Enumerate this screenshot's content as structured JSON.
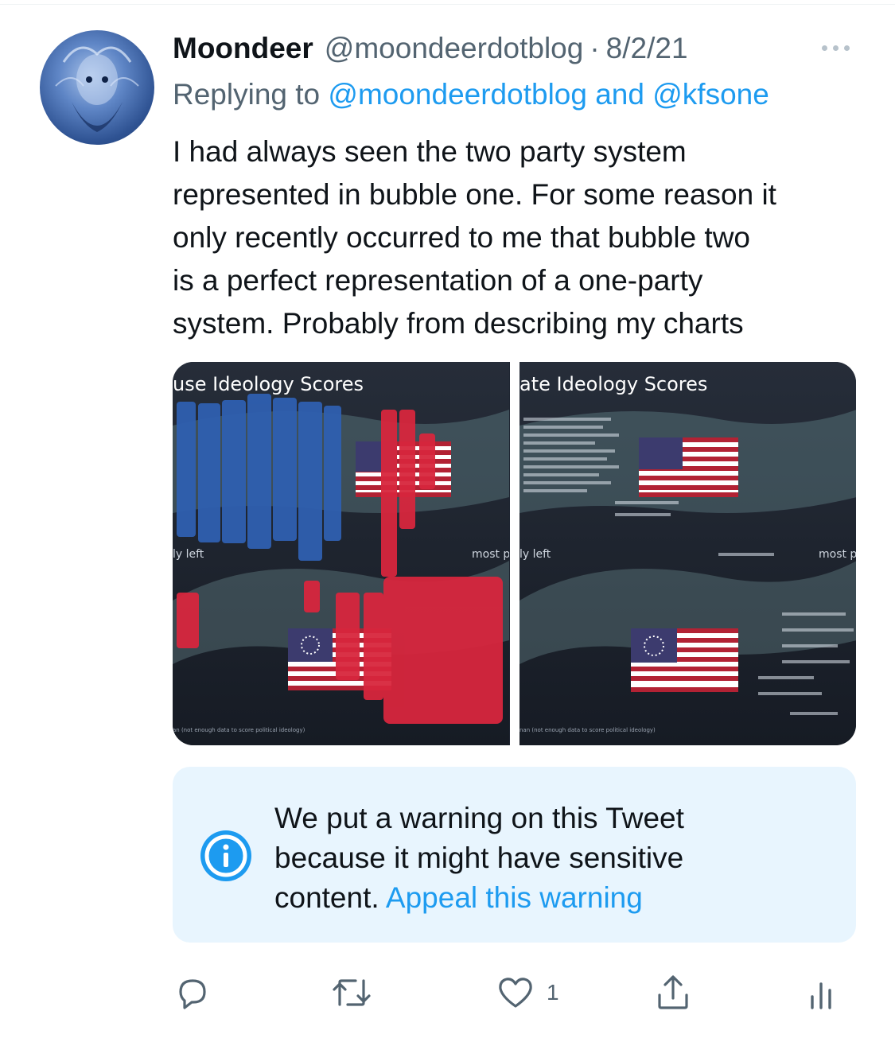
{
  "tweet": {
    "author_name": "Moondeer",
    "author_handle": "@moondeerdotblog",
    "separator": "·",
    "date": "8/2/21",
    "replying_prefix": "Replying to",
    "reply_mention_1": "@moondeerdotblog",
    "reply_joiner": "and",
    "reply_mention_2": "@kfsone",
    "text_lines": [
      "I had always seen the two party system",
      "represented in bubble one. For some reason it",
      "only recently occurred to me that bubble two",
      "is a perfect representation of a one-party",
      "system. Probably from describing my charts"
    ]
  },
  "media": {
    "left_panel": {
      "title": "use Ideology Scores",
      "left_label": "ly left",
      "right_label": "most p",
      "footnote": "an (not enough data to score political ideology)"
    },
    "right_panel": {
      "title": "ate Ideology Scores",
      "left_label": "ly left",
      "right_label": "most p",
      "footnote": "nan (not enough data to score political ideology)"
    }
  },
  "warning": {
    "lines": [
      "We put a warning on this Tweet",
      "because it might have sensitive",
      "content."
    ],
    "appeal_link": "Appeal this warning",
    "icon": "info-icon"
  },
  "actions": {
    "reply_icon": "reply-icon",
    "retweet_icon": "retweet-icon",
    "like_icon": "heart-icon",
    "like_count": "1",
    "share_icon": "share-icon",
    "analytics_icon": "analytics-icon"
  },
  "colors": {
    "link": "#1d9bf0",
    "secondary_text": "#536471",
    "warning_bg": "#e8f5fe",
    "chart_bg": "#1d2430"
  }
}
